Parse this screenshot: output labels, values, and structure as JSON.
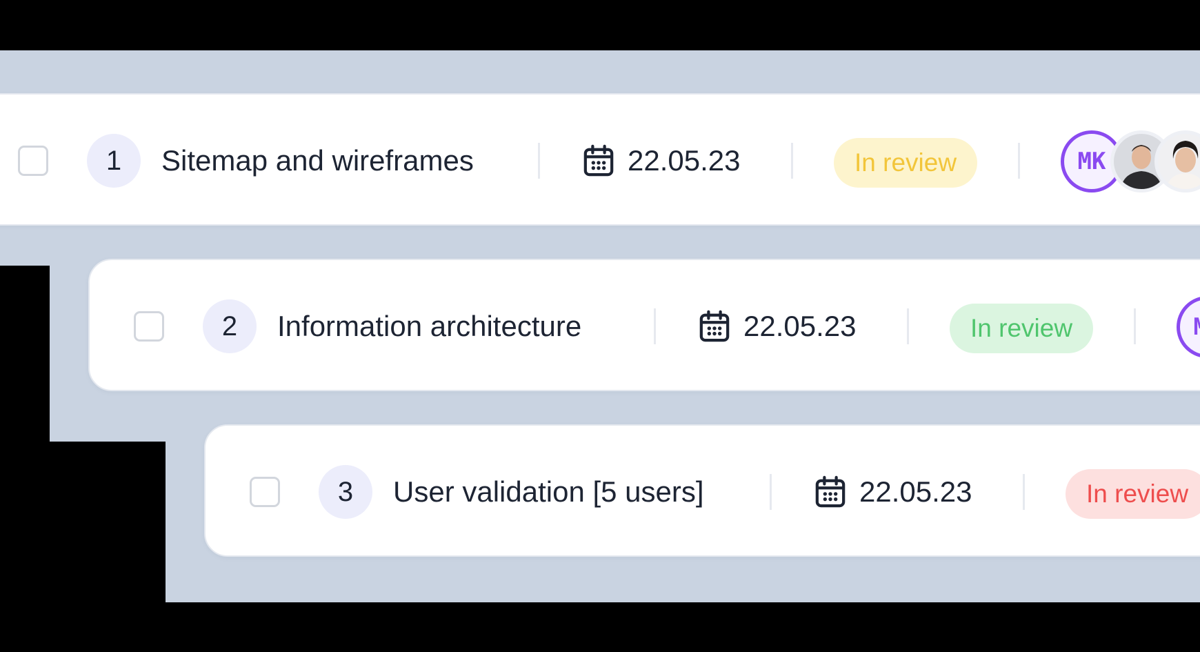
{
  "tasks": [
    {
      "number": "1",
      "title": "Sitemap and wireframes",
      "date": "22.05.23",
      "status": "In review",
      "status_color": "#f2c53a",
      "assignee_initials": "MK"
    },
    {
      "number": "2",
      "title": "Information architecture",
      "date": "22.05.23",
      "status": "In review",
      "status_color": "#4fc56d",
      "assignee_initials": "MK"
    },
    {
      "number": "3",
      "title": "User validation [5 users]",
      "date": "22.05.23",
      "status": "In review",
      "status_color": "#ee4d4d"
    }
  ],
  "icons": {
    "date": "calendar-icon",
    "select": "checkbox"
  },
  "colors": {
    "badge_bg": "#ecedfb",
    "avatar_accent": "#8a4af0",
    "backdrop": "#c9d3e1"
  }
}
